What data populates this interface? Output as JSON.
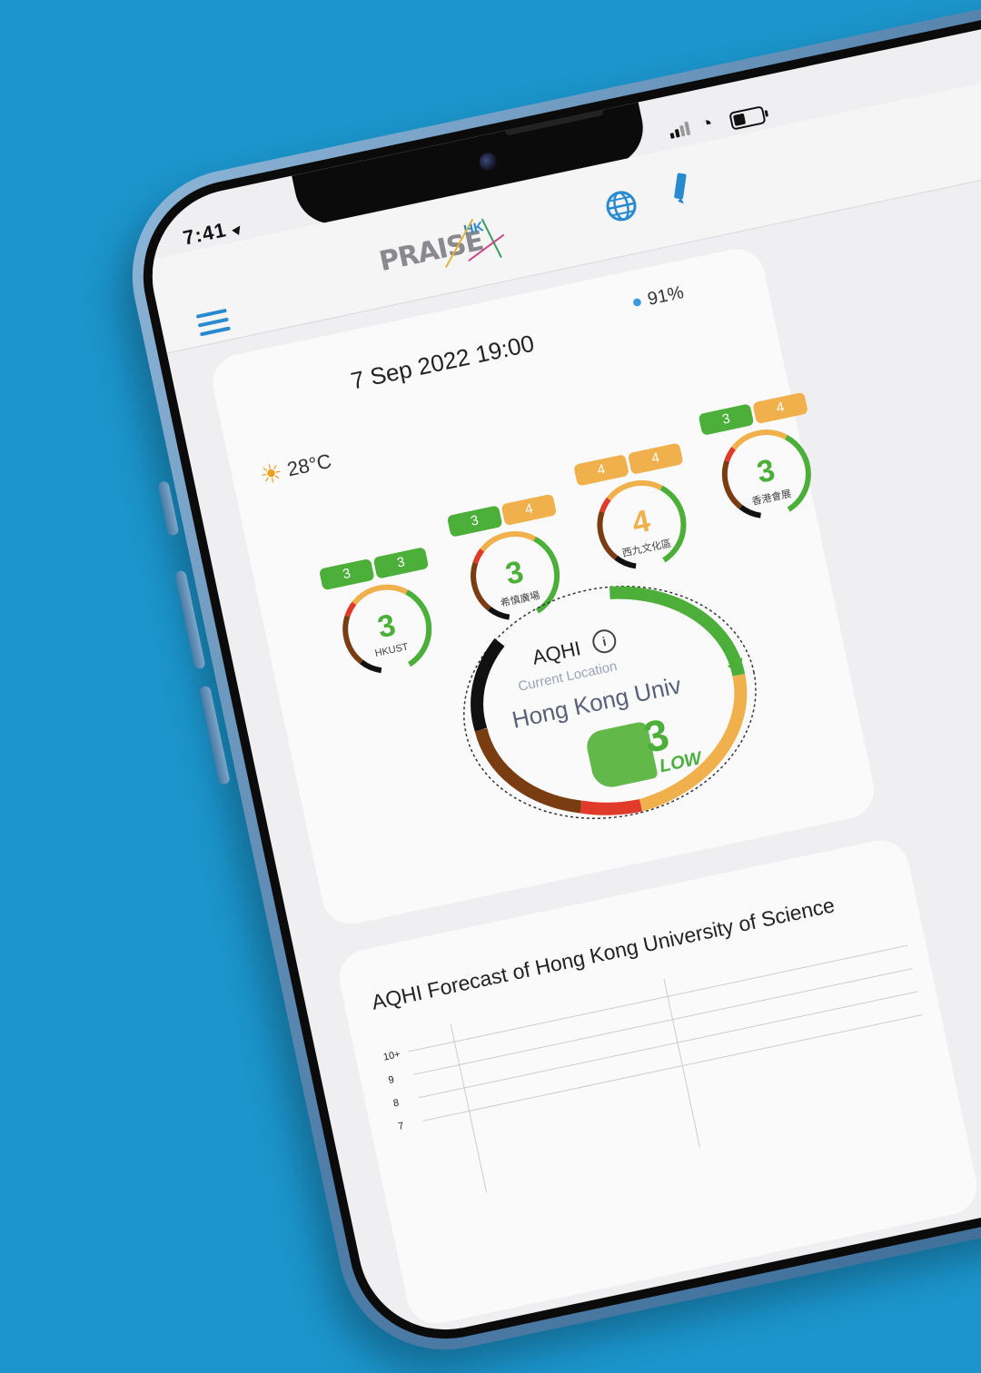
{
  "status_bar": {
    "time": "7:41"
  },
  "header": {
    "logo_text": "PRAISE",
    "logo_sub": "HK"
  },
  "summary": {
    "datetime": "7 Sep 2022 19:00",
    "humidity": "91%",
    "temperature": "28°C"
  },
  "stations": [
    {
      "name": "HKUST",
      "aqhi": "3",
      "tags": [
        "3",
        "3"
      ],
      "tag_colors": [
        "#4caf3a",
        "#4caf3a"
      ],
      "value_color": "#4caf3a"
    },
    {
      "name": "希慎廣場",
      "aqhi": "3",
      "tags": [
        "3",
        "4"
      ],
      "tag_colors": [
        "#4caf3a",
        "#f0b04c"
      ],
      "value_color": "#4caf3a"
    },
    {
      "name": "西九文化區",
      "aqhi": "4",
      "tags": [
        "4",
        "4"
      ],
      "tag_colors": [
        "#f0b04c",
        "#f0b04c"
      ],
      "value_color": "#f0b04c"
    },
    {
      "name": "香港會展",
      "aqhi": "3",
      "tags": [
        "3",
        "4"
      ],
      "tag_colors": [
        "#4caf3a",
        "#f0b04c"
      ],
      "value_color": "#4caf3a"
    }
  ],
  "current": {
    "label": "AQHI",
    "info_icon": "i",
    "sublabel": "Current Location",
    "location": "Hong Kong Univ",
    "aqhi": "3",
    "level": "LOW",
    "risk_fraction": 0.27
  },
  "forecast": {
    "title": "AQHI Forecast of Hong Kong University of Science",
    "y_ticks": [
      "10+",
      "9",
      "8",
      "7"
    ]
  },
  "colors": {
    "low": "#4caf3a",
    "moderate": "#f0b04c",
    "high": "#e03a2a",
    "very_high": "#7a3d12",
    "serious": "#111111",
    "accent": "#2a8ad0"
  }
}
